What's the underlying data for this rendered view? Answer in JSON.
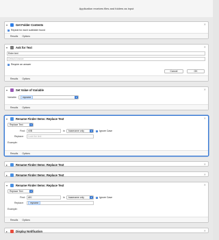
{
  "window": {
    "title": "Application receives files and folders as input"
  },
  "actions": {
    "get_folder": {
      "title": "Get Folder Contents",
      "repeat_label": "Repeat for each subfolder found",
      "tabs": [
        "Results",
        "Options"
      ],
      "color": "#2f7fe8"
    },
    "ask_text": {
      "title": "Ask for Text",
      "prompt_value": "Enter text",
      "default_placeholder": "Default Answer",
      "require_label": "Require an answer",
      "cancel_label": "Cancel",
      "ok_label": "OK",
      "tabs": [
        "Results",
        "Options"
      ],
      "color": "#6a6a6a"
    },
    "set_variable": {
      "title": "Set Value of Variable",
      "variable_label": "Variable:",
      "variable_value": "myname",
      "tabs": [
        "Results",
        "Options"
      ],
      "color": "#9b59b6"
    },
    "rename1": {
      "title": "Rename Finder Items: Replace Text",
      "mode_value": "Replace Text",
      "find_label": "Find:",
      "find_value": "n0B",
      "in_label": "in",
      "scope_value": "basename only",
      "ignore_case_label": "Ignore Case",
      "replace_label": "Replace:",
      "replace_placeholder": "Look the text",
      "example_label": "Example:",
      "tabs": [
        "Results",
        "Options"
      ],
      "color": "#4a90e2"
    },
    "rename2": {
      "title": "Rename Finder Items: Replace Text",
      "color": "#4a90e2"
    },
    "rename3": {
      "title": "Rename Finder Items: Replace Text",
      "color": "#4a90e2"
    },
    "rename4": {
      "title": "Rename Finder Items: Replace Text",
      "mode_value": "Replace Text",
      "find_label": "Find:",
      "find_value": "AKI",
      "in_label": "in",
      "scope_value": "basename only",
      "ignore_case_label": "Ignore Case",
      "replace_label": "Replace:",
      "replace_token": "myname",
      "example_label": "Example:",
      "tabs": [
        "Results",
        "Options"
      ],
      "color": "#4a90e2"
    },
    "notify": {
      "title": "Display Notification",
      "color": "#e74c3c"
    }
  },
  "icons": {
    "disclosure": "chevron-down-icon",
    "collapsed": "chevron-right-icon",
    "close": "close-icon"
  }
}
